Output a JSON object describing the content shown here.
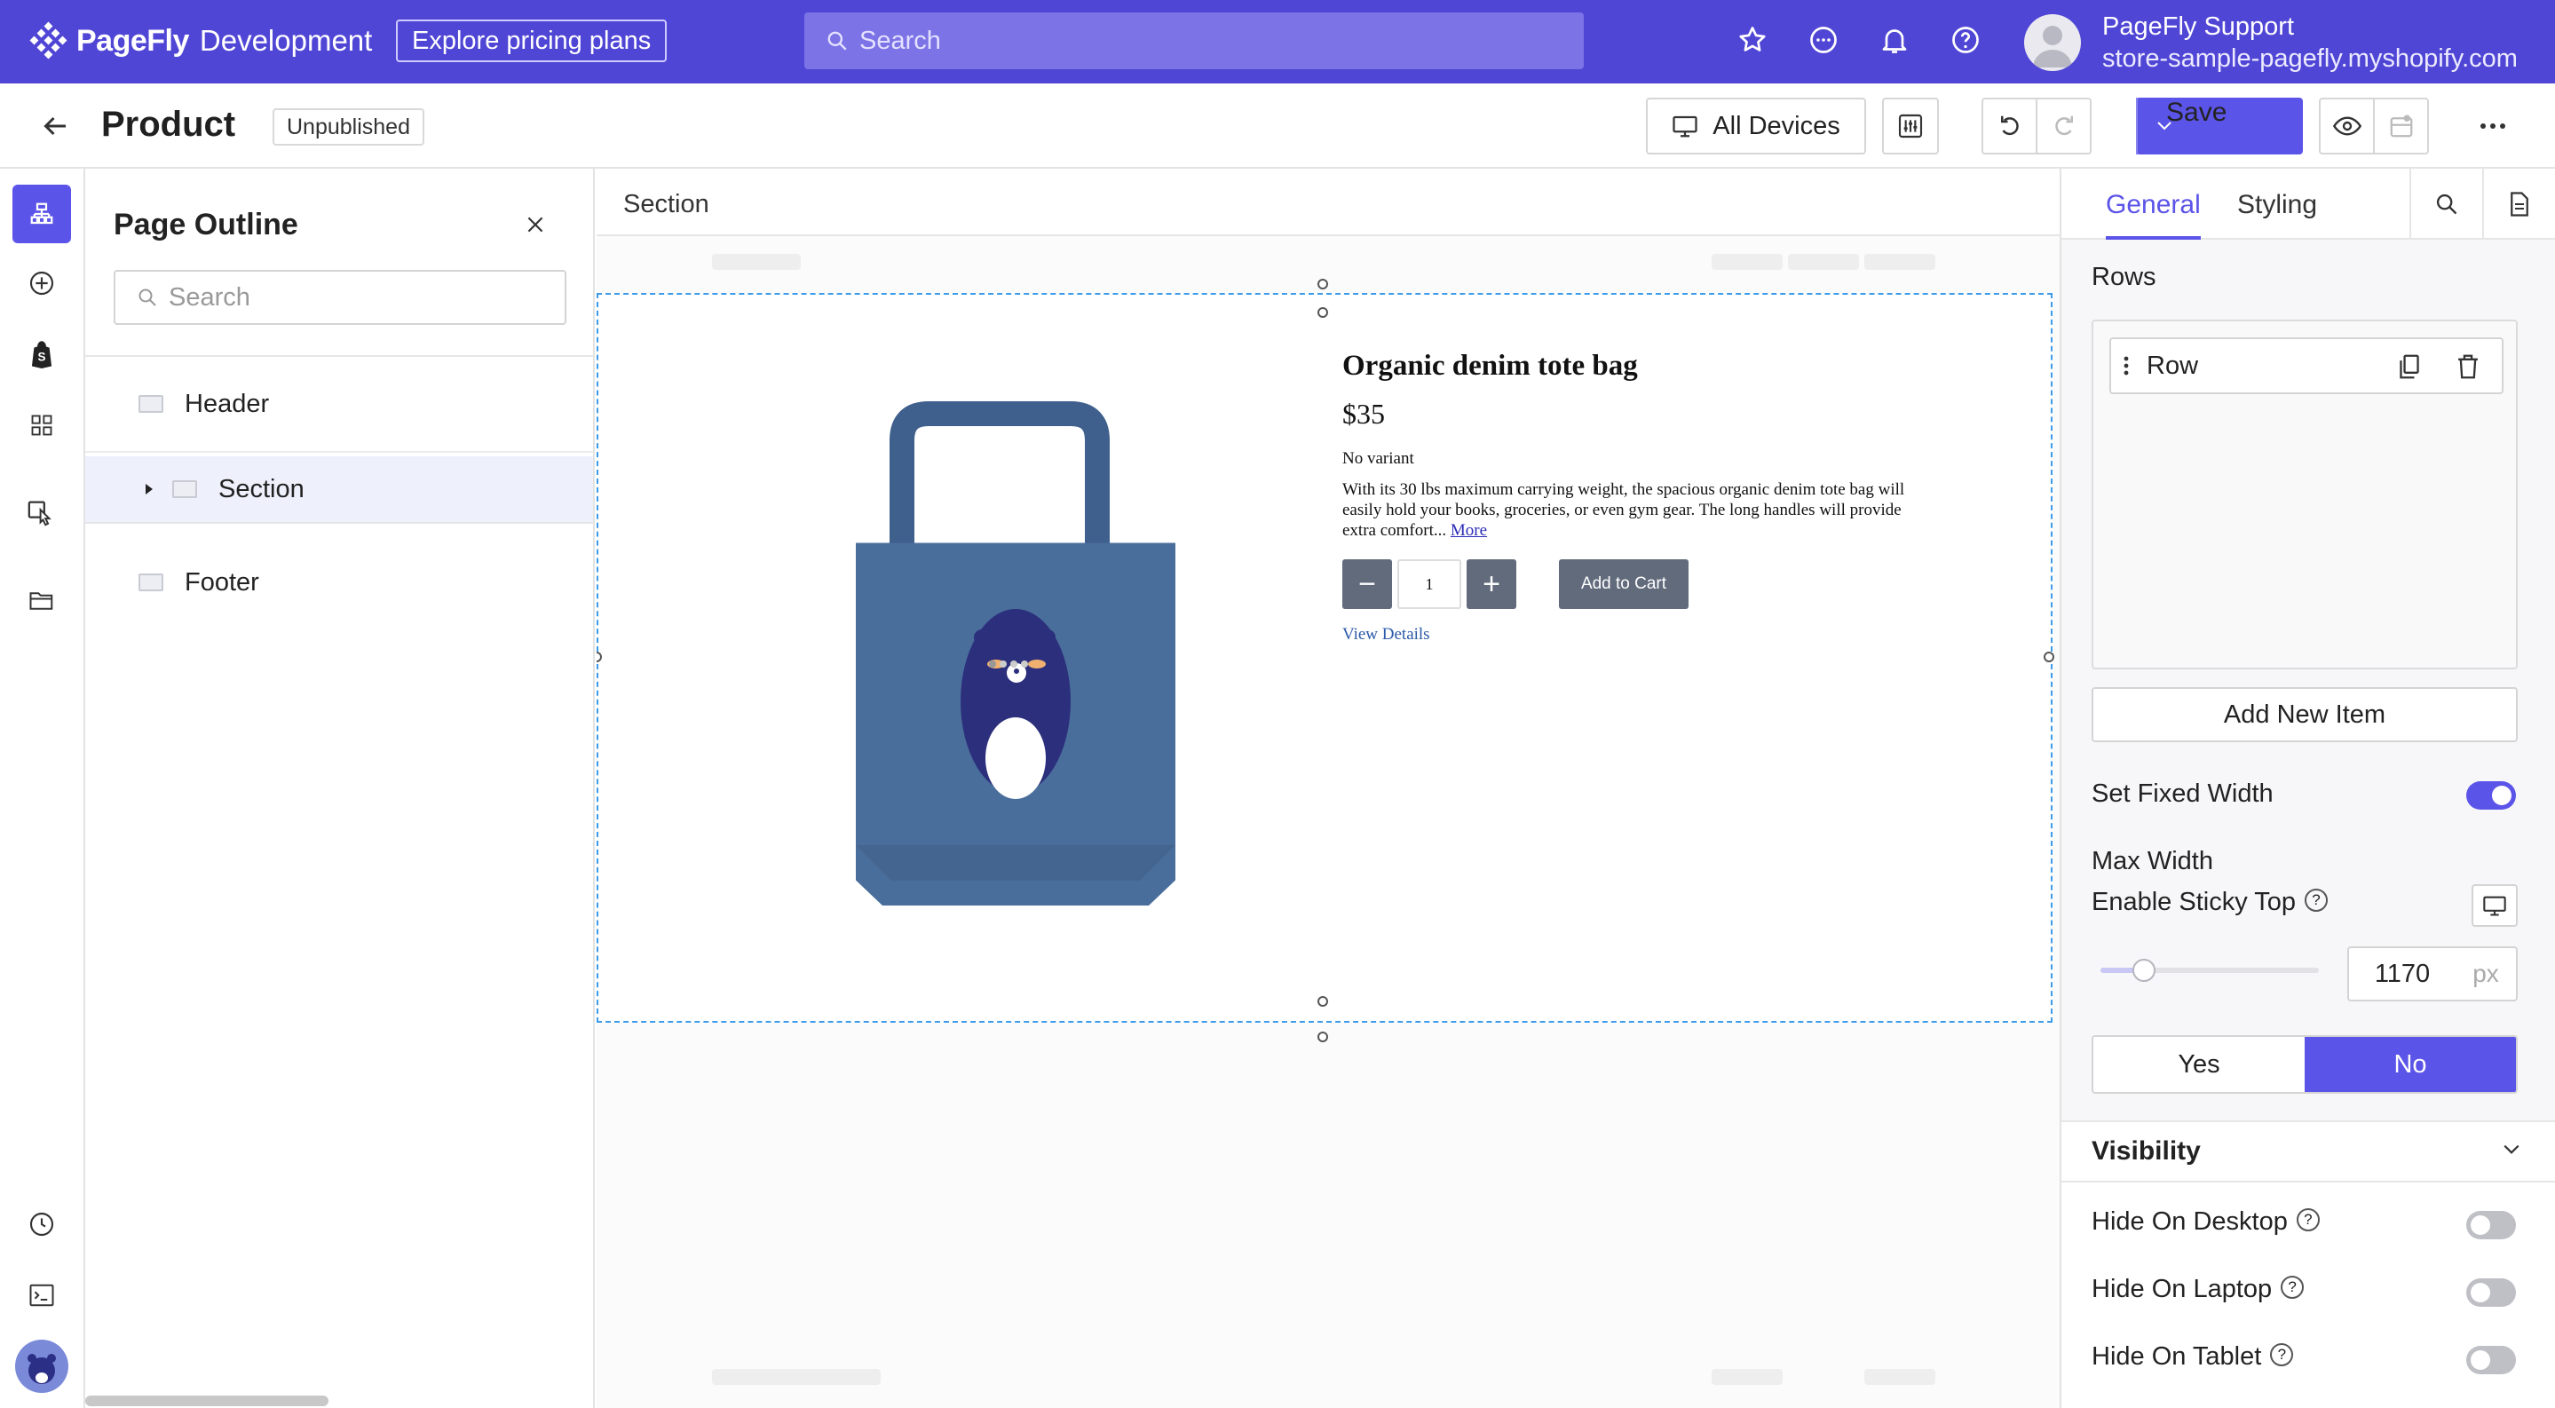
{
  "topbar": {
    "brand": "PageFly",
    "env": "Development",
    "pricing_label": "Explore pricing plans",
    "search_placeholder": "Search",
    "user_name": "PageFly Support",
    "user_store": "store-sample-pagefly.myshopify.com",
    "icons": [
      "star-icon",
      "chat-icon",
      "bell-icon",
      "help-icon"
    ]
  },
  "toolbar": {
    "title": "Product",
    "status": "Unpublished",
    "devices_label": "All Devices",
    "save_label": "Save"
  },
  "rail": {
    "icons": [
      "page-outline-icon",
      "add-element-icon",
      "shopify-icon",
      "apps-icon",
      "interaction-icon",
      "folder-icon",
      "history-icon",
      "terminal-icon",
      "avatar-icon"
    ]
  },
  "outline": {
    "title": "Page Outline",
    "search_placeholder": "Search",
    "items": [
      {
        "label": "Header"
      },
      {
        "label": "Section"
      },
      {
        "label": "Footer"
      }
    ]
  },
  "canvas": {
    "breadcrumb": "Section",
    "product": {
      "name": "Organic denim tote bag",
      "price": "$35",
      "variant": "No variant",
      "description": "With its 30 lbs maximum carrying weight, the spacious organic denim tote bag will easily hold your books, groceries, or even gym gear. The long handles will provide extra comfort...",
      "more_link": "More",
      "quantity": "1",
      "add_to_cart": "Add to Cart",
      "view_details": "View Details",
      "minus": "−",
      "plus": "+"
    }
  },
  "inspector": {
    "tabs": [
      {
        "label": "General"
      },
      {
        "label": "Styling"
      }
    ],
    "rows_label": "Rows",
    "row_item": "Row",
    "add_new_item": "Add New Item",
    "fixed_width_label": "Set Fixed Width",
    "fixed_width_on": true,
    "max_width_label": "Max Width",
    "max_width_value": "1170",
    "max_width_unit": "px",
    "slider_fraction": 0.2,
    "sticky_label": "Enable Sticky Top",
    "sticky_options": [
      "Yes",
      "No"
    ],
    "sticky_selected": "No",
    "visibility_title": "Visibility",
    "visibility_items": [
      {
        "label": "Hide On Desktop",
        "on": false
      },
      {
        "label": "Hide On Laptop",
        "on": false
      },
      {
        "label": "Hide On Tablet",
        "on": false
      }
    ],
    "accent_color": "#5b54e8"
  }
}
